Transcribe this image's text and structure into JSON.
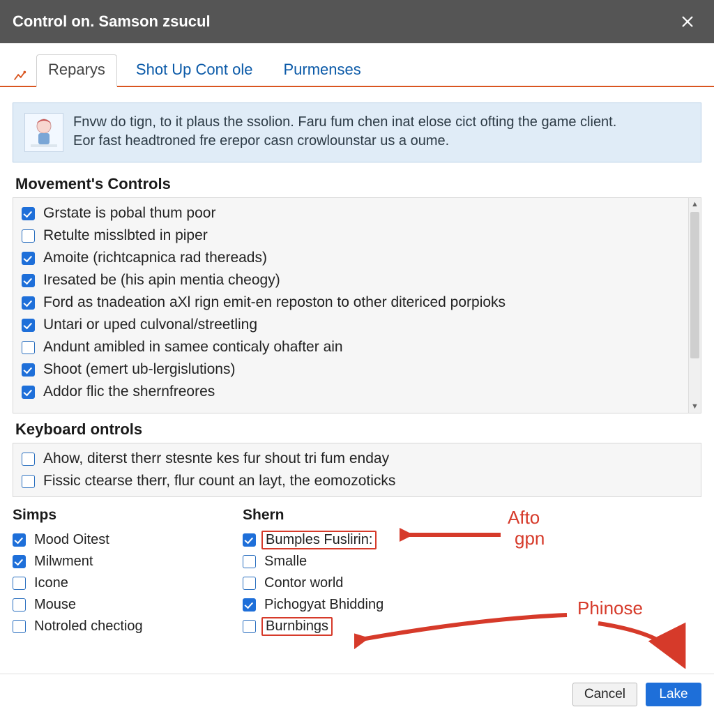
{
  "window": {
    "title": "Control on. Samson zsucul"
  },
  "tabs": {
    "items": [
      {
        "label": "Reparys",
        "active": true
      },
      {
        "label": "Shot Up Cont ole",
        "active": false
      },
      {
        "label": "Purmenses",
        "active": false
      }
    ]
  },
  "notice": {
    "line1": "Fnvw do tign, to it plaus the ssolion. Faru fum chen inat elose cict ofting the game client.",
    "line2": "Eor fast headtroned fre erepor casn crowlounstar us a oume."
  },
  "movement_section": {
    "title": "Movement's Controls",
    "items": [
      {
        "checked": true,
        "label": "Grstate is pobal thum poor"
      },
      {
        "checked": false,
        "label": "Retulte misslbted in piper"
      },
      {
        "checked": true,
        "label": "Amoite (richtcapnica rad thereads)"
      },
      {
        "checked": true,
        "label": "Iresated be (his apin mentia cheogy)"
      },
      {
        "checked": true,
        "label": "Ford as tnadeation aXl rign emit-en reposton to other ditericed porpioks"
      },
      {
        "checked": true,
        "label": "Untari or uped culvonal/streetling"
      },
      {
        "checked": false,
        "label": "Andunt amibled in samee conticaly ohafter ain"
      },
      {
        "checked": true,
        "label": "Shoot (emert ub-lergislutions)"
      },
      {
        "checked": true,
        "label": "Addor flic the shernfreores"
      }
    ]
  },
  "keyboard_section": {
    "title": "Keyboard ontrols",
    "items": [
      {
        "checked": false,
        "label": "Ahow, diterst therr stesnte kes fur shout tri fum enday"
      },
      {
        "checked": false,
        "label": "Fissic ctearse therr, flur count an layt, the eomozoticks"
      }
    ]
  },
  "simps_section": {
    "title": "Simps",
    "items": [
      {
        "checked": true,
        "label": "Mood Oitest"
      },
      {
        "checked": true,
        "label": "Milwment"
      },
      {
        "checked": false,
        "label": "Icone"
      },
      {
        "checked": false,
        "label": "Mouse"
      },
      {
        "checked": false,
        "label": "Notroled chectiog"
      }
    ]
  },
  "shern_section": {
    "title": "Shern",
    "items": [
      {
        "checked": true,
        "label": "Bumples Fuslirin:",
        "highlight": true
      },
      {
        "checked": false,
        "label": "Smalle"
      },
      {
        "checked": false,
        "label": "Contor world"
      },
      {
        "checked": true,
        "label": "Pichogyat Bhidding"
      },
      {
        "checked": false,
        "label": "Burnbings",
        "highlight": true
      }
    ]
  },
  "callouts": {
    "afto": "Afto",
    "gpn": "gpn",
    "phinose": "Phinose"
  },
  "footer": {
    "cancel": "Cancel",
    "ok": "Lake"
  },
  "colors": {
    "accent": "#d9551f",
    "link": "#0b5aa8",
    "primary": "#1e6fd9",
    "callout": "#d63a2a"
  }
}
